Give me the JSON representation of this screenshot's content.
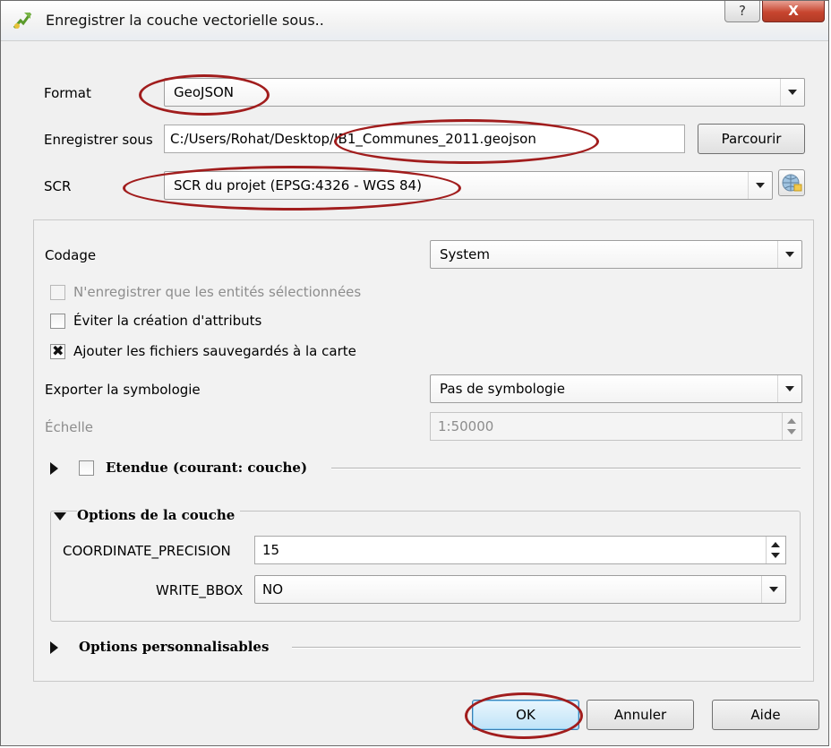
{
  "window": {
    "title": "Enregistrer la couche vectorielle sous..",
    "help_glyph": "?",
    "close_glyph": "X"
  },
  "form": {
    "format_label": "Format",
    "format_value": "GeoJSON",
    "save_as_label": "Enregistrer sous",
    "save_as_value": "C:/Users/Rohat/Desktop/IB1_Communes_2011.geojson",
    "browse_label": "Parcourir",
    "crs_label": "SCR",
    "crs_value": "SCR du projet (EPSG:4326 - WGS 84)"
  },
  "panel": {
    "encoding_label": "Codage",
    "encoding_value": "System",
    "checkboxes": [
      {
        "label": "N'enregistrer que les entités sélectionnées",
        "checked": false,
        "enabled": false
      },
      {
        "label": "Éviter la création d'attributs",
        "checked": false,
        "enabled": true
      },
      {
        "label": "Ajouter les fichiers sauvegardés à la carte",
        "checked": true,
        "enabled": true
      }
    ],
    "check_glyph": "✖",
    "symbology_label": "Exporter la symbologie",
    "symbology_value": "Pas de symbologie",
    "scale_label": "Échelle",
    "scale_value": "1:50000",
    "extent_title": "Etendue (courant: couche)",
    "layer_options_title": "Options de la couche",
    "coord_precision_label": "COORDINATE_PRECISION",
    "coord_precision_value": "15",
    "write_bbox_label": "WRITE_BBOX",
    "write_bbox_value": "NO",
    "custom_options_title": "Options personnalisables"
  },
  "buttons": {
    "ok": "OK",
    "cancel": "Annuler",
    "help": "Aide"
  },
  "colors": {
    "annotation_oval": "#a11d1d",
    "close_button": "#c7452f"
  }
}
